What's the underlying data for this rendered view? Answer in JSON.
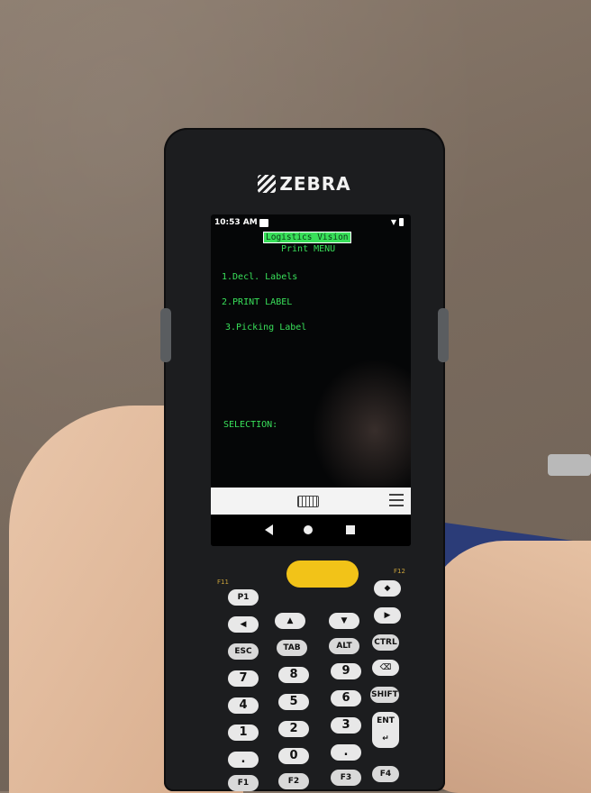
{
  "device": {
    "brand": "ZEBRA",
    "status_time": "10:53 AM"
  },
  "terminal": {
    "app_title": "Logistics Vision",
    "menu_title": "Print MENU",
    "items": [
      {
        "label": "1.Decl. Labels"
      },
      {
        "label": "2.PRINT LABEL"
      },
      {
        "label": "3.Picking Label"
      }
    ],
    "selection_prompt": "SELECTION:"
  },
  "keypad": {
    "f11": "F11",
    "f12": "F12",
    "p1": "P1",
    "esc": "ESC",
    "tab": "TAB",
    "alt": "ALT",
    "ctrl": "CTRL",
    "shift": "SHIFT",
    "ent": "ENT",
    "digits": [
      "7",
      "8",
      "9",
      "4",
      "5",
      "6",
      "1",
      "2",
      "3",
      ".",
      "0",
      "."
    ],
    "f1": "F1",
    "f2": "F2",
    "f3": "F3",
    "f4": "F4"
  },
  "icons": {
    "nav_back": "back-triangle-icon",
    "nav_home": "home-circle-icon",
    "nav_recent": "recent-square-icon",
    "keyboard": "keyboard-icon",
    "menu": "hamburger-menu-icon"
  },
  "colors": {
    "terminal_text": "#39e05a",
    "trigger": "#f2c318"
  }
}
